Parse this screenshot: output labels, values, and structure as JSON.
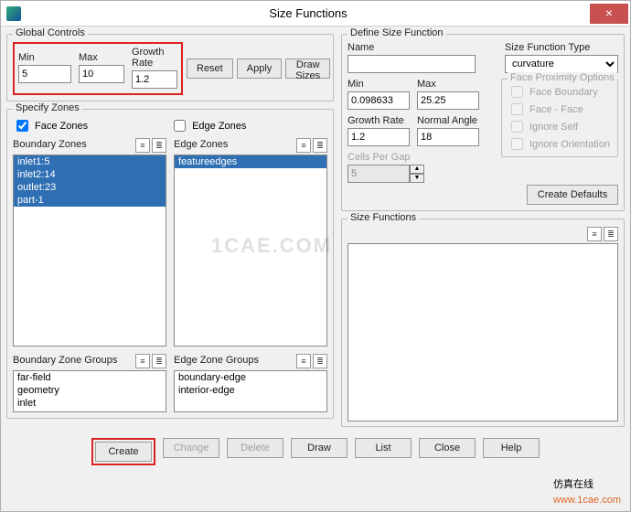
{
  "window": {
    "title": "Size Functions",
    "close": "×"
  },
  "global": {
    "title": "Global Controls",
    "min_lbl": "Min",
    "min_val": "5",
    "max_lbl": "Max",
    "max_val": "10",
    "gr_lbl": "Growth Rate",
    "gr_val": "1.2",
    "reset": "Reset",
    "apply": "Apply",
    "draw": "Draw Sizes"
  },
  "zones": {
    "title": "Specify Zones",
    "face_chk": "Face Zones",
    "edge_chk": "Edge Zones",
    "bz_title": "Boundary Zones",
    "ez_title": "Edge Zones",
    "bz_items": [
      "inlet1:5",
      "inlet2:14",
      "outlet:23",
      "part-1"
    ],
    "ez_items": [
      "featureedges"
    ],
    "bzg_title": "Boundary Zone Groups",
    "ezg_title": "Edge Zone Groups",
    "bzg_items": [
      "far-field",
      "geometry",
      "inlet"
    ],
    "ezg_items": [
      "boundary-edge",
      "interior-edge"
    ]
  },
  "def": {
    "title": "Define Size Function",
    "name_lbl": "Name",
    "name_val": "",
    "type_lbl": "Size Function Type",
    "type_val": "curvature",
    "min_lbl": "Min",
    "min_val": "0.098633",
    "max_lbl": "Max",
    "max_val": "25.25",
    "gr_lbl": "Growth Rate",
    "gr_val": "1.2",
    "na_lbl": "Normal Angle",
    "na_val": "18",
    "cpg_lbl": "Cells Per Gap",
    "cpg_val": "5",
    "fp_title": "Face Proximity Options",
    "fp1": "Face Boundary",
    "fp2": "Face - Face",
    "fp3": "Ignore Self",
    "fp4": "Ignore Orientation",
    "create_def": "Create Defaults"
  },
  "sf": {
    "title": "Size Functions"
  },
  "footer": {
    "create": "Create",
    "change": "Change",
    "delete": "Delete",
    "draw": "Draw",
    "list": "List",
    "close": "Close",
    "help": "Help"
  },
  "watermark": "1CAE.COM",
  "wm2a": "仿真在线",
  "wm2b": "www.1cae.com"
}
